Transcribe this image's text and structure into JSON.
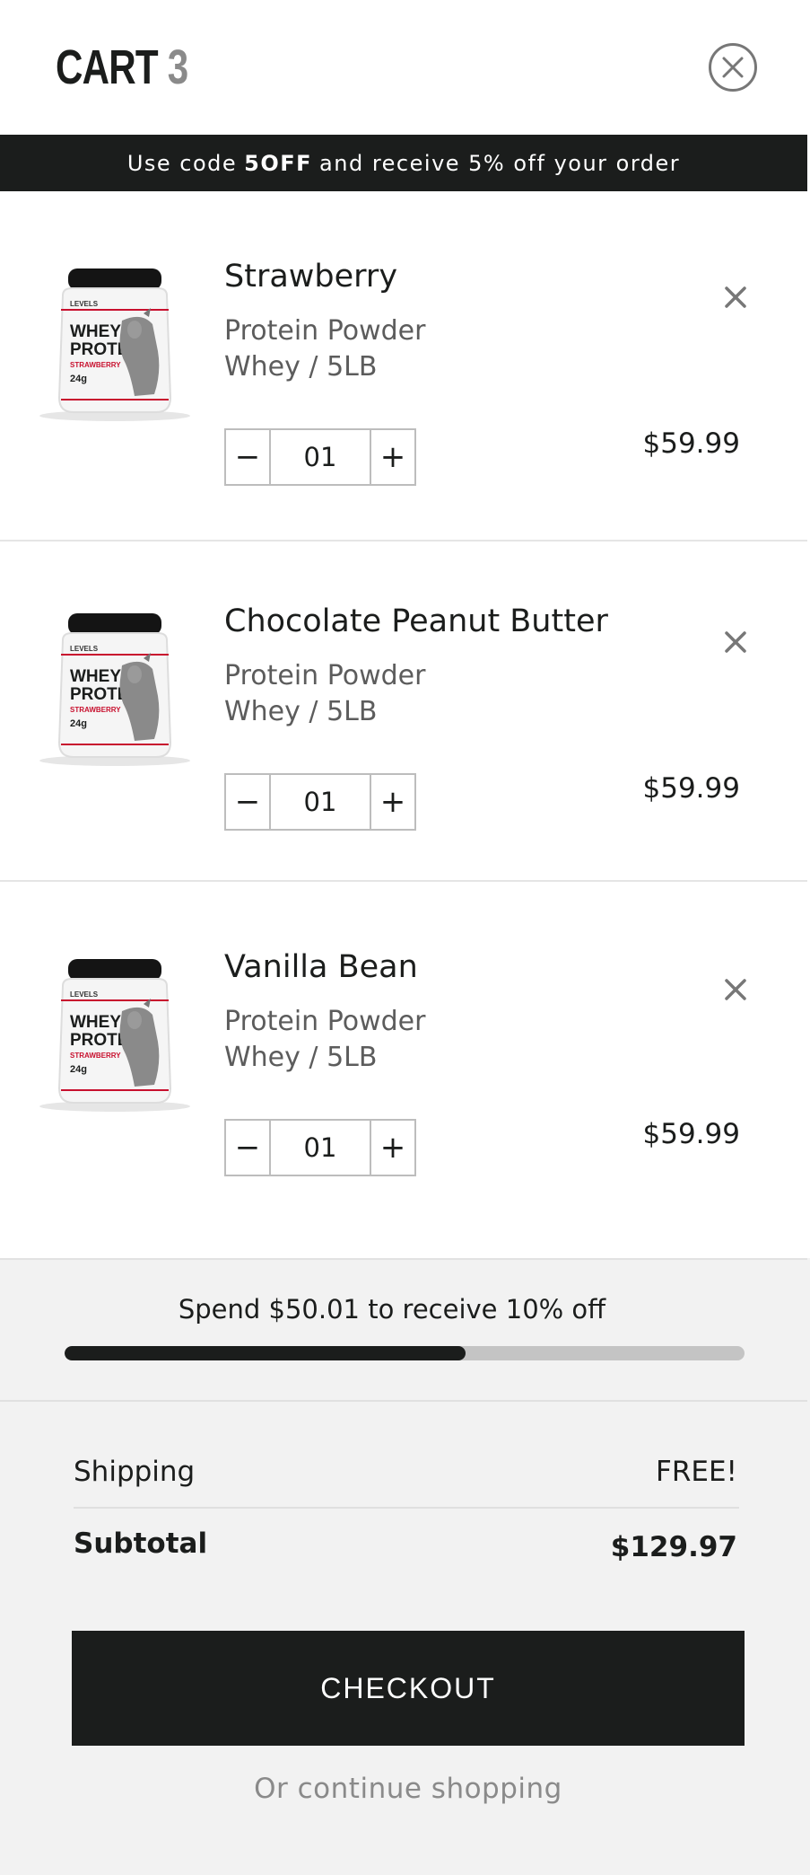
{
  "header": {
    "title": "CART",
    "count": "3"
  },
  "promo": {
    "prefix": "Use code",
    "code": "5OFF",
    "suffix": "and receive 5% off your order"
  },
  "items": [
    {
      "name": "Strawberry",
      "category": "Protein Powder",
      "variant": "Whey / 5LB",
      "quantity": "01",
      "price": "$59.99"
    },
    {
      "name": "Chocolate Peanut Butter",
      "category": "Protein Powder",
      "variant": "Whey / 5LB",
      "quantity": "01",
      "price": "$59.99"
    },
    {
      "name": "Vanilla Bean",
      "category": "Protein Powder",
      "variant": "Whey / 5LB",
      "quantity": "01",
      "price": "$59.99"
    }
  ],
  "product_image": {
    "brand": "LEVELS",
    "line1": "WHEY",
    "line2": "PROTEIN",
    "flavor": "STRAWBERRY",
    "servings": "24g"
  },
  "footer": {
    "spend_message": "Spend $50.01 to receive 10% off",
    "progress_fraction": 0.59,
    "shipping_label": "Shipping",
    "shipping_value": "FREE!",
    "subtotal_label": "Subtotal",
    "subtotal_value": "$129.97",
    "checkout_label": "CHECKOUT",
    "continue_label": "Or continue shopping"
  },
  "colors": {
    "dark": "#1b1d1c",
    "muted": "#5c5c5c",
    "footer_bg": "#f2f2f2",
    "accent_red": "#c8102e"
  },
  "icons": {
    "close": "close-circle-icon",
    "remove": "x-icon",
    "minus": "minus-icon",
    "plus": "plus-icon"
  }
}
